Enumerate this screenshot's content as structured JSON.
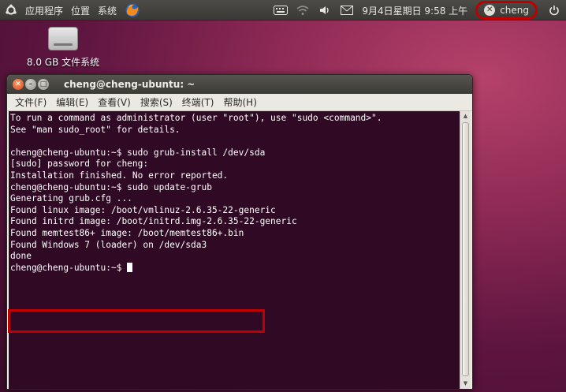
{
  "panel": {
    "applications": "应用程序",
    "places": "位置",
    "system": "系统",
    "datetime": "9月4日星期日 9:58 上午",
    "username": "cheng"
  },
  "desktop": {
    "drive_label": "8.0 GB 文件系统"
  },
  "window": {
    "title": "cheng@cheng-ubuntu: ~",
    "menu": [
      "文件(F)",
      "编辑(E)",
      "查看(V)",
      "搜索(S)",
      "终端(T)",
      "帮助(H)"
    ]
  },
  "terminal": {
    "lines": [
      "To run a command as administrator (user \"root\"), use \"sudo <command>\".",
      "See \"man sudo_root\" for details.",
      "",
      "cheng@cheng-ubuntu:~$ sudo grub-install /dev/sda",
      "[sudo] password for cheng:",
      "Installation finished. No error reported.",
      "cheng@cheng-ubuntu:~$ sudo update-grub",
      "Generating grub.cfg ...",
      "Found linux image: /boot/vmlinuz-2.6.35-22-generic",
      "Found initrd image: /boot/initrd.img-2.6.35-22-generic",
      "Found memtest86+ image: /boot/memtest86+.bin",
      "Found Windows 7 (loader) on /dev/sda3",
      "done"
    ],
    "prompt": "cheng@cheng-ubuntu:~$ "
  },
  "colors": {
    "terminal_bg": "#300a24",
    "highlight": "#c00000",
    "panel_bg": "#3c3b37"
  },
  "icons": [
    "ubuntu-logo-icon",
    "firefox-icon",
    "keyboard-icon",
    "wifi-icon",
    "volume-icon",
    "mail-icon",
    "user-icon",
    "power-icon",
    "drive-icon",
    "close-icon",
    "minimize-icon",
    "maximize-icon"
  ]
}
